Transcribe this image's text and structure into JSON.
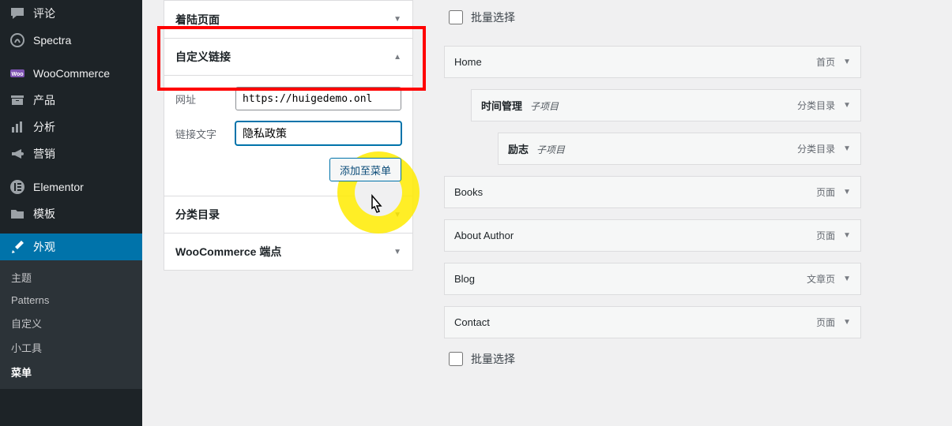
{
  "sidebar": {
    "items": [
      {
        "icon": "comment",
        "label": "评论"
      },
      {
        "icon": "spectra",
        "label": "Spectra"
      },
      {
        "icon": "woo",
        "label": "WooCommerce"
      },
      {
        "icon": "archive",
        "label": "产品"
      },
      {
        "icon": "bars",
        "label": "分析"
      },
      {
        "icon": "megaphone",
        "label": "营销"
      },
      {
        "icon": "elementor",
        "label": "Elementor"
      },
      {
        "icon": "folder",
        "label": "模板"
      },
      {
        "icon": "brush",
        "label": "外观"
      }
    ],
    "submenu": [
      {
        "label": "主题",
        "active": false
      },
      {
        "label": "Patterns",
        "active": false
      },
      {
        "label": "自定义",
        "active": false
      },
      {
        "label": "小工具",
        "active": false
      },
      {
        "label": "菜单",
        "active": true
      }
    ]
  },
  "accordion": {
    "items": [
      {
        "label": "着陆页面",
        "expanded": false
      },
      {
        "label": "自定义链接",
        "expanded": true
      },
      {
        "label": "分类目录",
        "expanded": false
      },
      {
        "label": "WooCommerce 端点",
        "expanded": false
      }
    ],
    "custom_link": {
      "url_label": "网址",
      "url_value": "https://huigedemo.onl",
      "text_label": "链接文字",
      "text_value": "隐私政策",
      "add_button": "添加至菜单"
    }
  },
  "right": {
    "bulk_label": "批量选择",
    "menu_items": [
      {
        "title": "Home",
        "sub": "",
        "type": "首页",
        "depth": 0,
        "bold": false
      },
      {
        "title": "时间管理",
        "sub": "子项目",
        "type": "分类目录",
        "depth": 1,
        "bold": true
      },
      {
        "title": "励志",
        "sub": "子项目",
        "type": "分类目录",
        "depth": 2,
        "bold": true
      },
      {
        "title": "Books",
        "sub": "",
        "type": "页面",
        "depth": 0,
        "bold": false
      },
      {
        "title": "About Author",
        "sub": "",
        "type": "页面",
        "depth": 0,
        "bold": false
      },
      {
        "title": "Blog",
        "sub": "",
        "type": "文章页",
        "depth": 0,
        "bold": false
      },
      {
        "title": "Contact",
        "sub": "",
        "type": "页面",
        "depth": 0,
        "bold": false
      }
    ]
  }
}
